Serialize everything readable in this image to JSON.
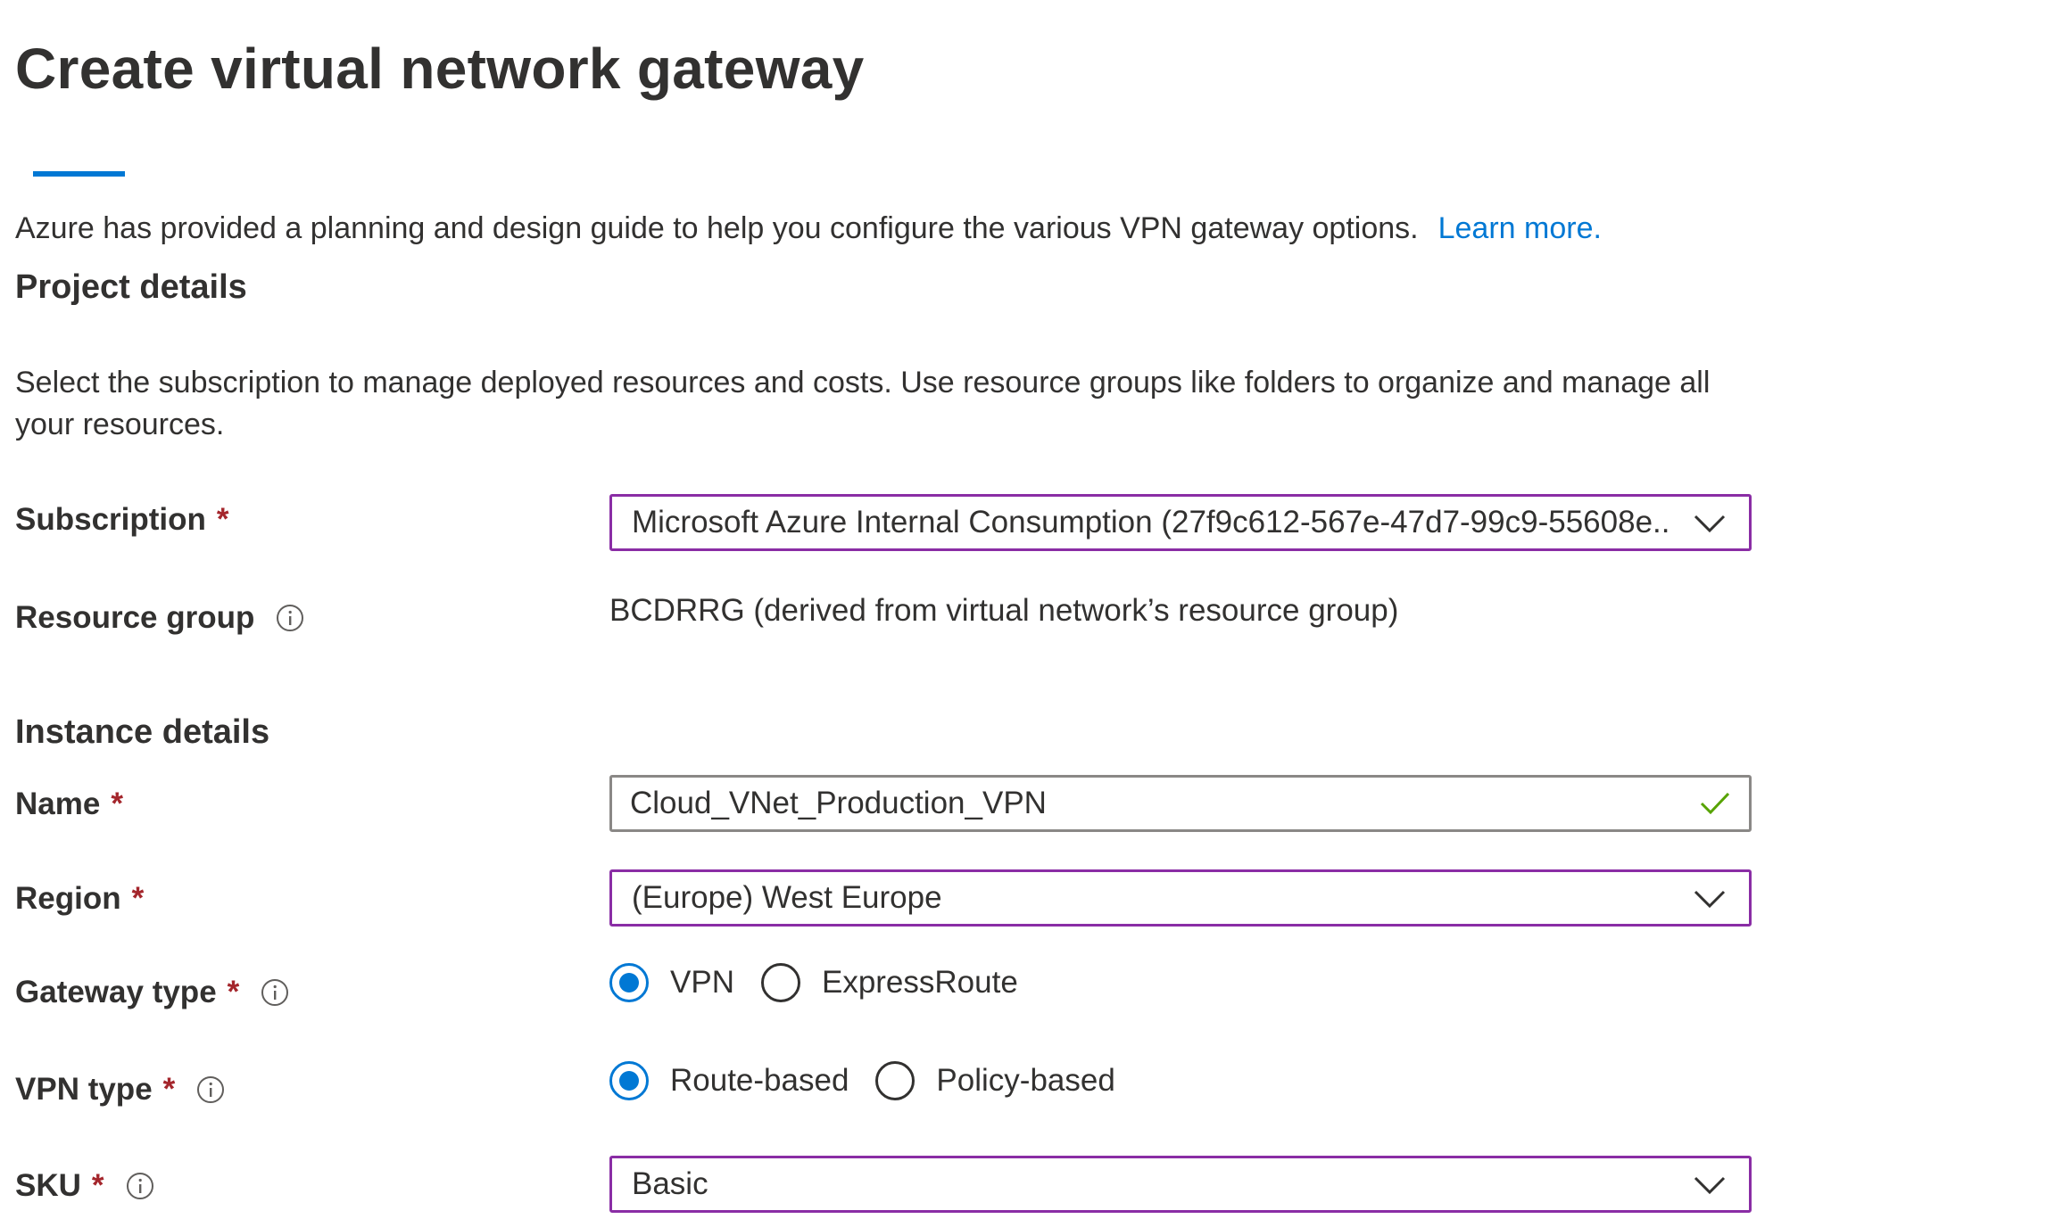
{
  "page": {
    "title": "Create virtual network gateway",
    "intro_text": "Azure has provided a planning and design guide to help you configure the various VPN gateway options.",
    "learn_more": "Learn more."
  },
  "project_details": {
    "heading": "Project details",
    "description": "Select the subscription to manage deployed resources and costs. Use resource groups like folders to organize and manage all your resources.",
    "subscription": {
      "label": "Subscription",
      "required_mark": "*",
      "value": "Microsoft Azure Internal Consumption (27f9c612-567e-47d7-99c9-55608e..."
    },
    "resource_group": {
      "label": "Resource group",
      "value": "BCDRRG (derived from virtual network’s resource group)"
    }
  },
  "instance_details": {
    "heading": "Instance details",
    "name": {
      "label": "Name",
      "required_mark": "*",
      "value": "Cloud_VNet_Production_VPN"
    },
    "region": {
      "label": "Region",
      "required_mark": "*",
      "value": "(Europe) West Europe"
    },
    "gateway_type": {
      "label": "Gateway type",
      "required_mark": "*",
      "options": [
        "VPN",
        "ExpressRoute"
      ],
      "selected": "VPN"
    },
    "vpn_type": {
      "label": "VPN type",
      "required_mark": "*",
      "options": [
        "Route-based",
        "Policy-based"
      ],
      "selected": "Route-based"
    },
    "sku": {
      "label": "SKU",
      "required_mark": "*",
      "value": "Basic"
    }
  },
  "colors": {
    "accent": "#0078d4",
    "focus_border": "#8a2da5",
    "required": "#a4262c",
    "valid_check": "#57a300",
    "text": "#323130"
  },
  "icons": {
    "info": "info-icon",
    "dropdown": "chevron-down-icon",
    "valid": "checkmark-icon"
  }
}
